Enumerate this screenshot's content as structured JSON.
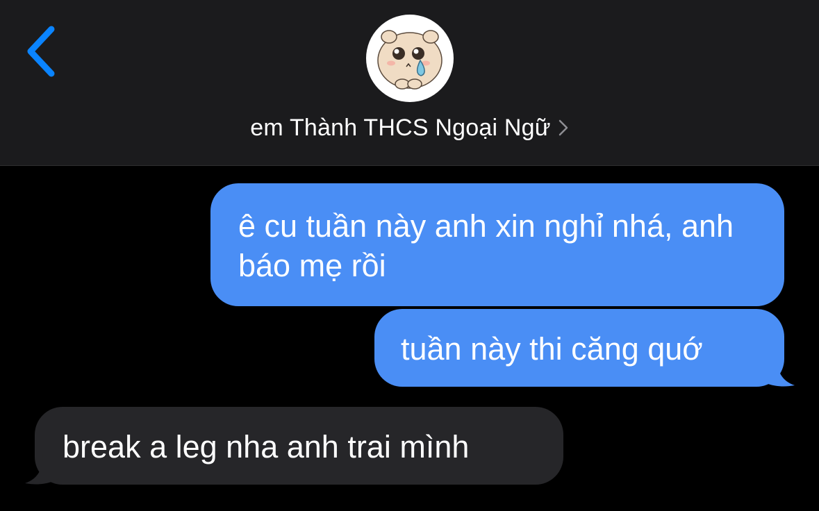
{
  "header": {
    "contact_name": "em Thành THCS Ngoại Ngữ",
    "back_icon": "chevron-left-icon",
    "detail_icon": "chevron-right-icon",
    "accent_color": "#0a84ff"
  },
  "messages": [
    {
      "direction": "outgoing",
      "text": "ê cu tuần này anh xin nghỉ nhá, anh báo mẹ rồi"
    },
    {
      "direction": "outgoing",
      "text": "tuần này thi căng quớ"
    },
    {
      "direction": "incoming",
      "text": "break a leg nha anh trai mình"
    }
  ],
  "colors": {
    "outgoing_bubble": "#4a8ef5",
    "incoming_bubble": "#262629",
    "background": "#000000",
    "header_background": "#1b1b1d"
  }
}
